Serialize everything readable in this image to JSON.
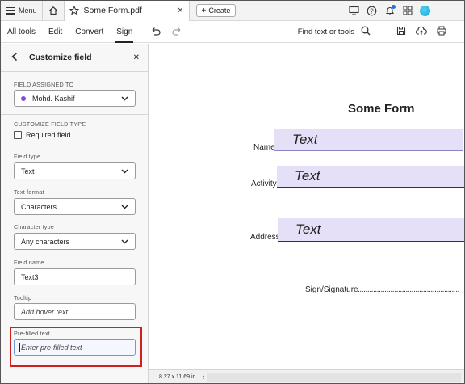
{
  "titlebar": {
    "menu_label": "Menu",
    "tab_title": "Some Form.pdf",
    "create_label": "Create"
  },
  "toolbar": {
    "tabs": [
      "All tools",
      "Edit",
      "Convert",
      "Sign"
    ],
    "active_tab": "Sign",
    "find_label": "Find text or tools"
  },
  "panel": {
    "title": "Customize field",
    "assigned_label": "FIELD ASSIGNED TO",
    "assigned_value": "Mohd. Kashif",
    "customize_type_label": "CUSTOMIZE FIELD TYPE",
    "required_label": "Required field",
    "field_type_label": "Field type",
    "field_type_value": "Text",
    "text_format_label": "Text format",
    "text_format_value": "Characters",
    "char_type_label": "Character type",
    "char_type_value": "Any characters",
    "field_name_label": "Field name",
    "field_name_value": "Text3",
    "tooltip_label": "Tooltip",
    "tooltip_placeholder": "Add hover text",
    "prefilled_label": "Pre-filled text",
    "prefilled_placeholder": "Enter pre-filled text"
  },
  "document": {
    "title": "Some Form",
    "fields": [
      {
        "label": "Name",
        "value": "Text"
      },
      {
        "label": "Activity",
        "value": "Text"
      },
      {
        "label": "Address",
        "value": "Text"
      }
    ],
    "sign_label": "Sign/Signature",
    "sign_dots": "....................................................."
  },
  "statusbar": {
    "page_size": "8.27 x 11.69 in"
  },
  "colors": {
    "field_fill": "#e5e0f8",
    "highlight": "#d11f1f",
    "assignee_dot": "#7b4fd6"
  }
}
